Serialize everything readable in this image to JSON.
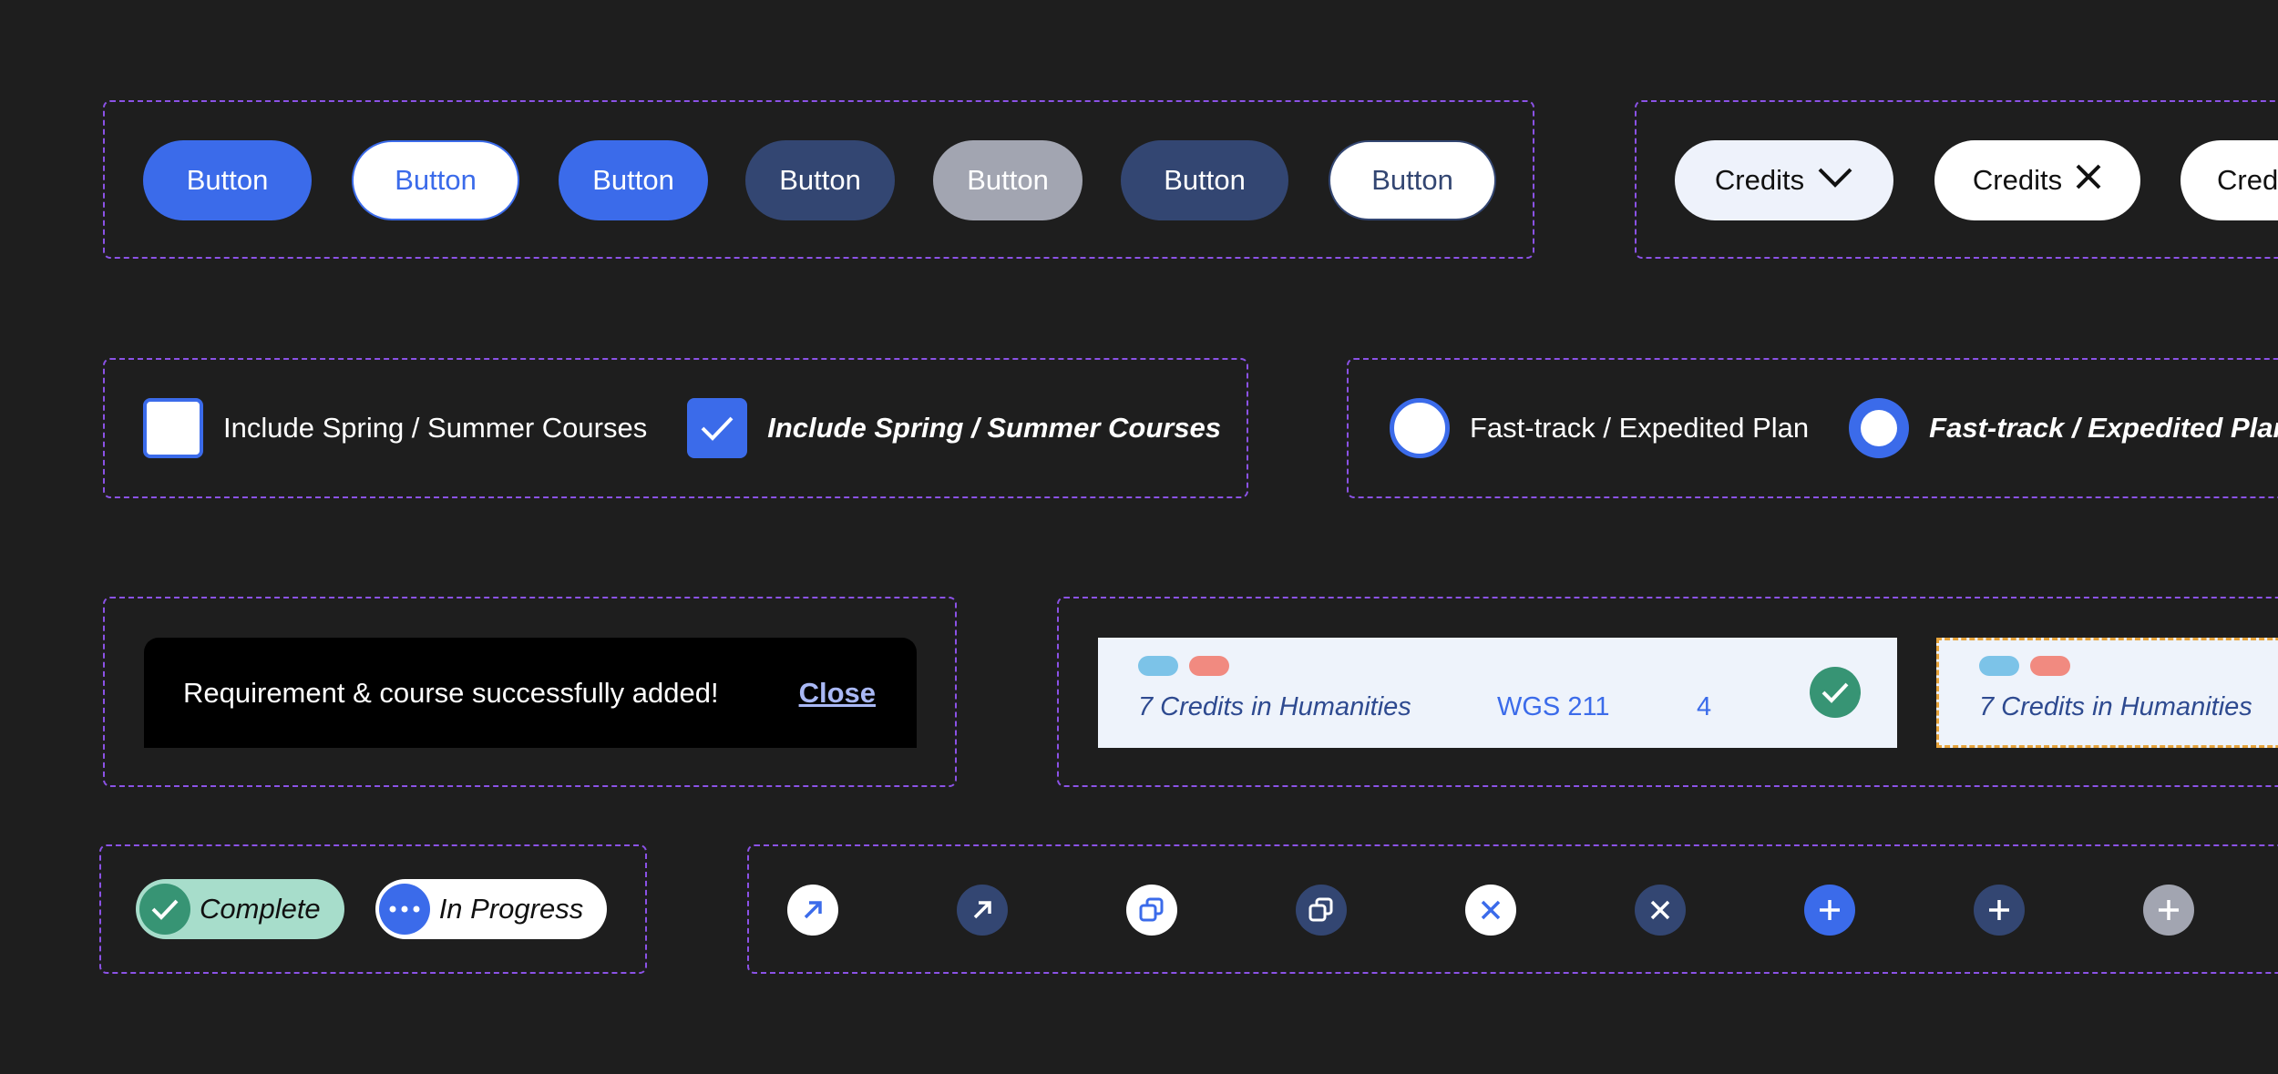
{
  "buttons": [
    "Button",
    "Button",
    "Button",
    "Button",
    "Button",
    "Button",
    "Button"
  ],
  "chips": {
    "dropdown_label": "Credits",
    "removable_label": "Credits",
    "partial_label": "Credits"
  },
  "checkboxes": {
    "unchecked_label": "Include Spring / Summer Courses",
    "checked_label": "Include Spring / Summer Courses"
  },
  "radios": {
    "unchecked_label": "Fast-track / Expedited Plan",
    "checked_label": "Fast-track / Expedited Plan"
  },
  "toast": {
    "message": "Requirement & course successfully added!",
    "close_label": "Close"
  },
  "course_cards": [
    {
      "title": "7 Credits in Humanities",
      "code": "WGS 211",
      "credits": "4",
      "status": "complete"
    },
    {
      "title": "7 Credits in Humanities",
      "status": "selected"
    }
  ],
  "status_badges": {
    "complete": "Complete",
    "in_progress": "In Progress"
  },
  "icon_buttons": [
    "arrow-up-right-icon",
    "arrow-up-right-icon",
    "duplicate-icon",
    "duplicate-icon",
    "close-icon",
    "close-icon",
    "plus-icon",
    "plus-icon",
    "plus-icon"
  ],
  "colors": {
    "background": "#1e1e1e",
    "group_outline": "#8b52e6",
    "primary": "#3b6bea",
    "navy": "#334672",
    "disabled": "#a2a5b1",
    "success": "#379474",
    "success_light": "#a7ddcb",
    "card_bg": "#eef3fb",
    "tag_blue": "#7cc3e8",
    "tag_red": "#f18a80",
    "selected_outline": "#e6a33b"
  }
}
